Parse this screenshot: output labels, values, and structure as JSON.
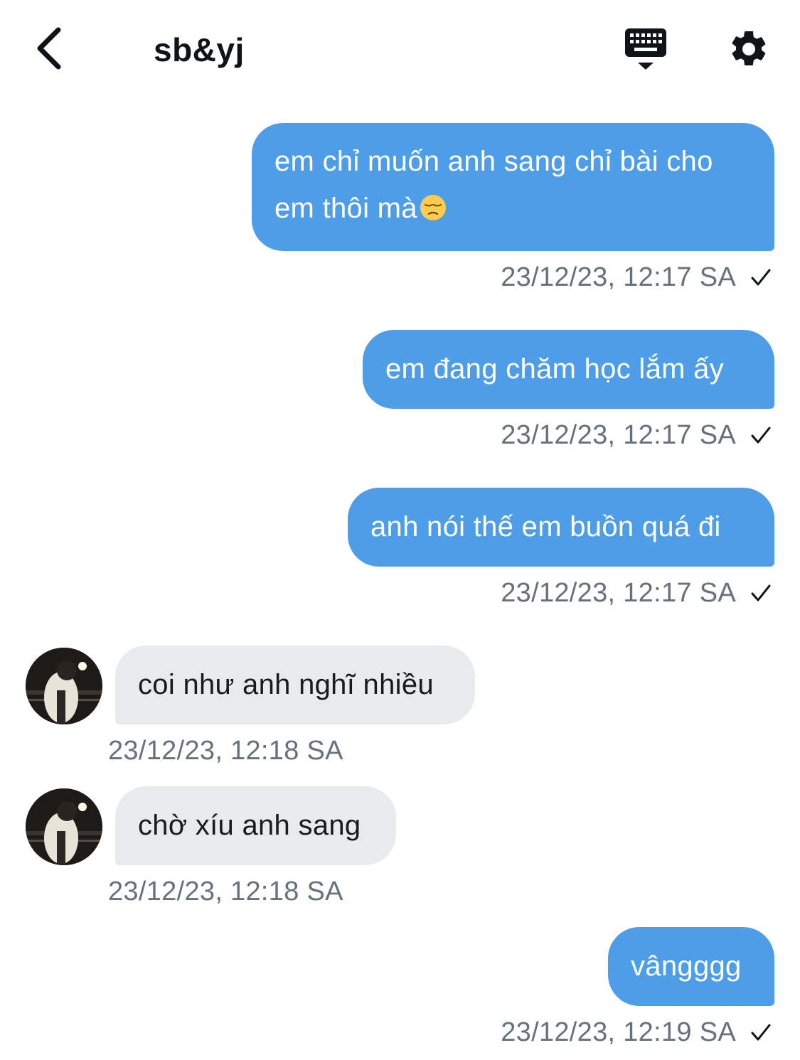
{
  "header": {
    "title": "sb&yj",
    "back_icon": "chevron-left-icon",
    "keyboard_icon": "keyboard-icon",
    "settings_icon": "gear-icon"
  },
  "colors": {
    "sent_bubble": "#4d9de8",
    "received_bubble": "#e8ebee",
    "meta_text": "#66717c"
  },
  "messages": [
    {
      "direction": "sent",
      "line1": "em chỉ muốn anh sang chỉ bài cho",
      "line2": "em thôi mà",
      "emoji": "pensive-face",
      "time": "23/12/23, 12:17 SA",
      "status_icon": "check-icon"
    },
    {
      "direction": "sent",
      "text": "em đang chăm học lắm ấy",
      "time": "23/12/23, 12:17 SA",
      "status_icon": "check-icon"
    },
    {
      "direction": "sent",
      "text": "anh nói thế em buồn quá đi",
      "time": "23/12/23, 12:17 SA",
      "status_icon": "check-icon"
    },
    {
      "direction": "received",
      "text": "coi như anh nghĩ nhiều",
      "time": "23/12/23, 12:18 SA"
    },
    {
      "direction": "received",
      "text": "chờ xíu anh sang",
      "time": "23/12/23, 12:18 SA"
    },
    {
      "direction": "sent",
      "text": "vângggg",
      "time": "23/12/23, 12:19 SA",
      "status_icon": "check-icon"
    }
  ]
}
